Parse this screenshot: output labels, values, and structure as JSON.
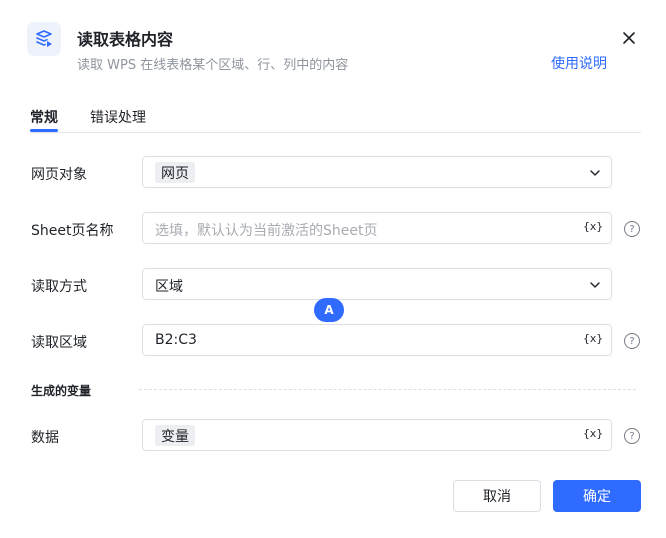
{
  "dialog": {
    "title": "读取表格内容",
    "subtitle": "读取 WPS 在线表格某个区域、行、列中的内容",
    "help_link": "使用说明"
  },
  "tabs": [
    {
      "label": "常规",
      "active": true
    },
    {
      "label": "错误处理",
      "active": false
    }
  ],
  "fields": {
    "web_object": {
      "label": "网页对象",
      "value": "网页"
    },
    "sheet_name": {
      "label": "Sheet页名称",
      "placeholder": "选填，默认认为当前激活的Sheet页"
    },
    "read_mode": {
      "label": "读取方式",
      "value": "区域"
    },
    "read_range": {
      "label": "读取区域",
      "value": "B2:C3"
    },
    "data": {
      "label": "数据",
      "value": "变量"
    }
  },
  "section": {
    "generated_vars": "生成的变量"
  },
  "var_button": "{x}",
  "badge": "A",
  "help_glyph": "?",
  "buttons": {
    "cancel": "取消",
    "ok": "确定"
  },
  "colors": {
    "accent": "#2f6bff",
    "chip_bg": "#eceef2"
  },
  "icons": {
    "app": "table-read-icon",
    "close": "close-icon",
    "dropdown": "chevron-down-icon",
    "help": "help-circle-icon"
  }
}
